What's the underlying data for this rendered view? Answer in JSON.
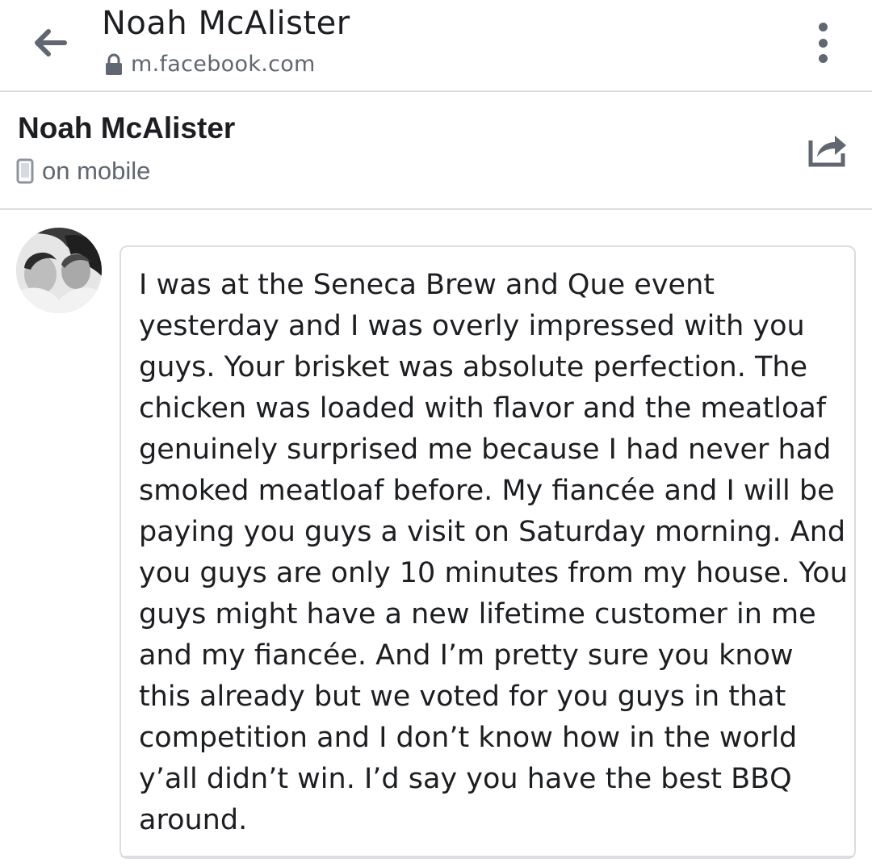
{
  "browser": {
    "title": "Noah McAlister",
    "url": "m.facebook.com",
    "icons": {
      "back": "back-arrow-icon",
      "lock": "lock-icon",
      "menu": "more-vertical-icon"
    }
  },
  "conversation": {
    "name": "Noah McAlister",
    "status": "on mobile",
    "icons": {
      "status": "mobile-phone-icon",
      "share": "share-icon"
    }
  },
  "message": {
    "text": "I was at the Seneca Brew and Que event yesterday and I was overly impressed with you guys. Your brisket was absolute perfection. The chicken was loaded with flavor and the meatloaf genuinely surprised me because I had never had smoked meatloaf before. My fiancée and I will be paying you guys a visit on Saturday morning. And you guys are only 10 minutes from my house. You guys might have a new lifetime customer in me and my fiancée. And I’m pretty sure you know this already but we voted for you guys in that competition and I don’t know how in the world y’all didn’t win. I’d say you have the best BBQ around."
  },
  "colors": {
    "text": "#1c1e21",
    "muted": "#606770",
    "divider": "#dadde1"
  }
}
